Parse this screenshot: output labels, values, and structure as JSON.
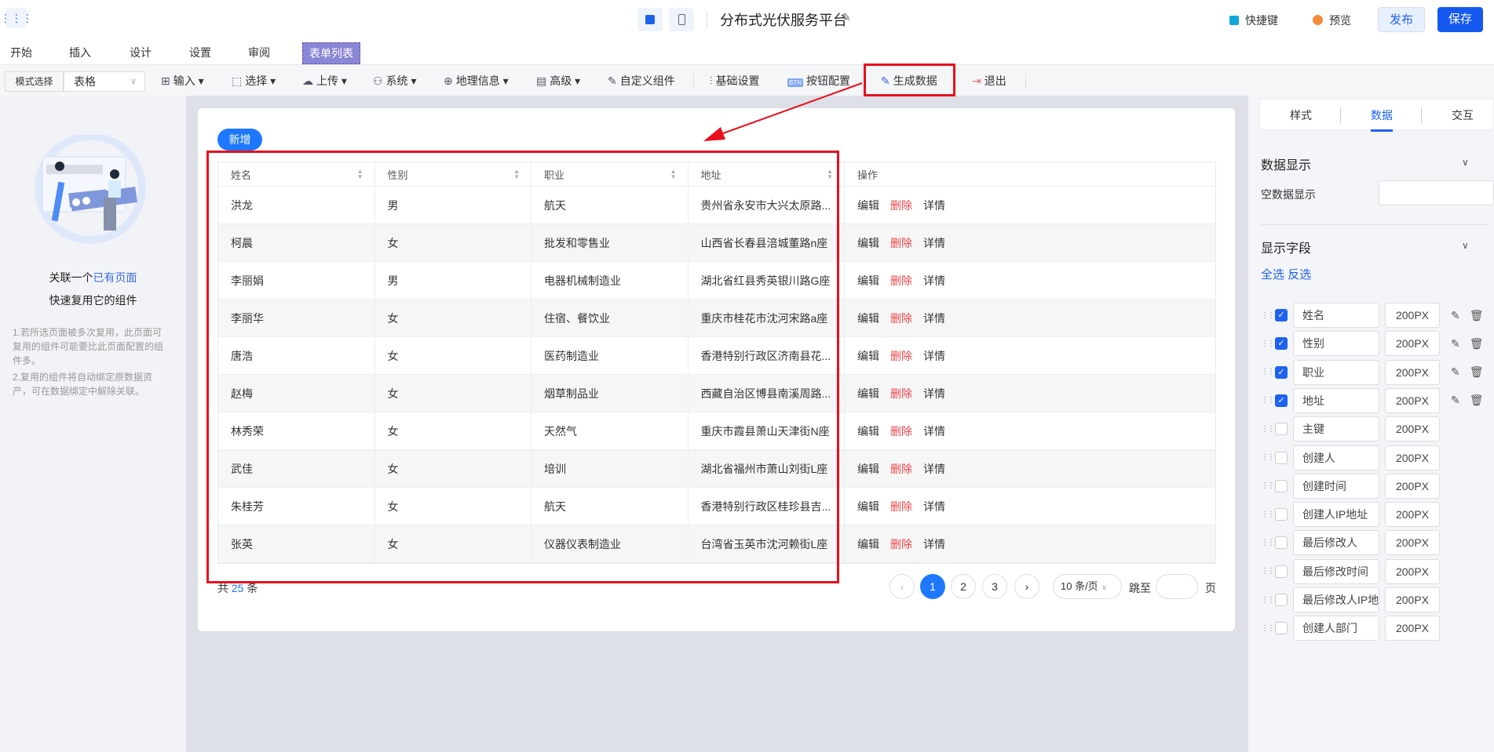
{
  "header": {
    "title": "分布式光伏服务平台",
    "shortcut": "快捷键",
    "preview": "预览",
    "publish": "发布",
    "save": "保存"
  },
  "tabs": [
    {
      "label": "开始"
    },
    {
      "label": "插入"
    },
    {
      "label": "设计"
    },
    {
      "label": "设置"
    },
    {
      "label": "审阅"
    },
    {
      "label": "表单列表",
      "active": true
    }
  ],
  "toolbar": {
    "mode_label": "模式选择",
    "mode_value": "表格",
    "items": [
      {
        "label": "输入",
        "icon": "input-icon"
      },
      {
        "label": "选择",
        "icon": "select-icon"
      },
      {
        "label": "上传",
        "icon": "upload-icon"
      },
      {
        "label": "系统",
        "icon": "system-icon"
      },
      {
        "label": "地理信息",
        "icon": "map-icon"
      },
      {
        "label": "高级",
        "icon": "advanced-icon"
      },
      {
        "label": "自定义组件",
        "icon": "edit-icon"
      },
      {
        "label": "基础设置",
        "icon": "sliders-icon"
      },
      {
        "label": "按钮配置",
        "icon": "btn-icon"
      },
      {
        "label": "生成数据",
        "icon": "generate-icon"
      },
      {
        "label": "退出",
        "icon": "exit-icon"
      }
    ]
  },
  "left": {
    "line1a": "关联一个",
    "line1b": "已有页面",
    "line2": "快速复用它的组件",
    "note1": "1.若所选页面被多次复用，此页面可复用的组件可能要比此页面配置的组件多。",
    "note2": "2.复用的组件将自动绑定原数据资产，可在数据绑定中解除关联。"
  },
  "main": {
    "add_label": "新增",
    "columns": [
      "姓名",
      "性别",
      "职业",
      "地址",
      "操作"
    ],
    "rows": [
      [
        "洪龙",
        "男",
        "航天",
        "贵州省永安市大兴太原路..."
      ],
      [
        "柯晨",
        "女",
        "批发和零售业",
        "山西省长春县涪城董路n座"
      ],
      [
        "李丽娟",
        "男",
        "电器机械制造业",
        "湖北省红县秀英银川路G座"
      ],
      [
        "李丽华",
        "女",
        "住宿、餐饮业",
        "重庆市桂花市沈河宋路a座"
      ],
      [
        "唐浩",
        "女",
        "医药制造业",
        "香港特别行政区济南县花..."
      ],
      [
        "赵梅",
        "女",
        "烟草制品业",
        "西藏自治区博县南溪周路..."
      ],
      [
        "林秀荣",
        "女",
        "天然气",
        "重庆市霞县萧山天津街N座"
      ],
      [
        "武佳",
        "女",
        "培训",
        "湖北省福州市萧山刘街L座"
      ],
      [
        "朱桂芳",
        "女",
        "航天",
        "香港特别行政区桂珍县吉..."
      ],
      [
        "张英",
        "女",
        "仪器仪表制造业",
        "台湾省玉英市沈河赖街L座"
      ]
    ],
    "actions": {
      "edit": "编辑",
      "delete": "删除",
      "detail": "详情"
    },
    "pagination": {
      "total_prefix": "共",
      "total": "25",
      "total_suffix": "条",
      "pages": [
        "1",
        "2",
        "3"
      ],
      "current": "1",
      "page_size": "10 条/页",
      "jump": "跳至",
      "page": "页"
    }
  },
  "right": {
    "tabs": [
      "样式",
      "数据",
      "交互"
    ],
    "active_tab": "数据",
    "section1": "数据显示",
    "empty_label": "空数据显示",
    "empty_value": "",
    "section2": "显示字段",
    "select_all": "全选",
    "invert": "反选",
    "fields": [
      {
        "name": "姓名",
        "width": "200PX",
        "checked": true
      },
      {
        "name": "性别",
        "width": "200PX",
        "checked": true
      },
      {
        "name": "职业",
        "width": "200PX",
        "checked": true
      },
      {
        "name": "地址",
        "width": "200PX",
        "checked": true
      },
      {
        "name": "主键",
        "width": "200PX",
        "checked": false
      },
      {
        "name": "创建人",
        "width": "200PX",
        "checked": false
      },
      {
        "name": "创建时间",
        "width": "200PX",
        "checked": false
      },
      {
        "name": "创建人IP地址",
        "width": "200PX",
        "checked": false
      },
      {
        "name": "最后修改人",
        "width": "200PX",
        "checked": false
      },
      {
        "name": "最后修改时间",
        "width": "200PX",
        "checked": false
      },
      {
        "name": "最后修改人IP地址",
        "width": "200PX",
        "checked": false
      },
      {
        "name": "创建人部门",
        "width": "200PX",
        "checked": false
      }
    ]
  },
  "colors": {
    "accent": "#1e78ff",
    "active_tab": "#8c86d6",
    "annotation": "#e8101c",
    "delete": "#f0454a"
  }
}
